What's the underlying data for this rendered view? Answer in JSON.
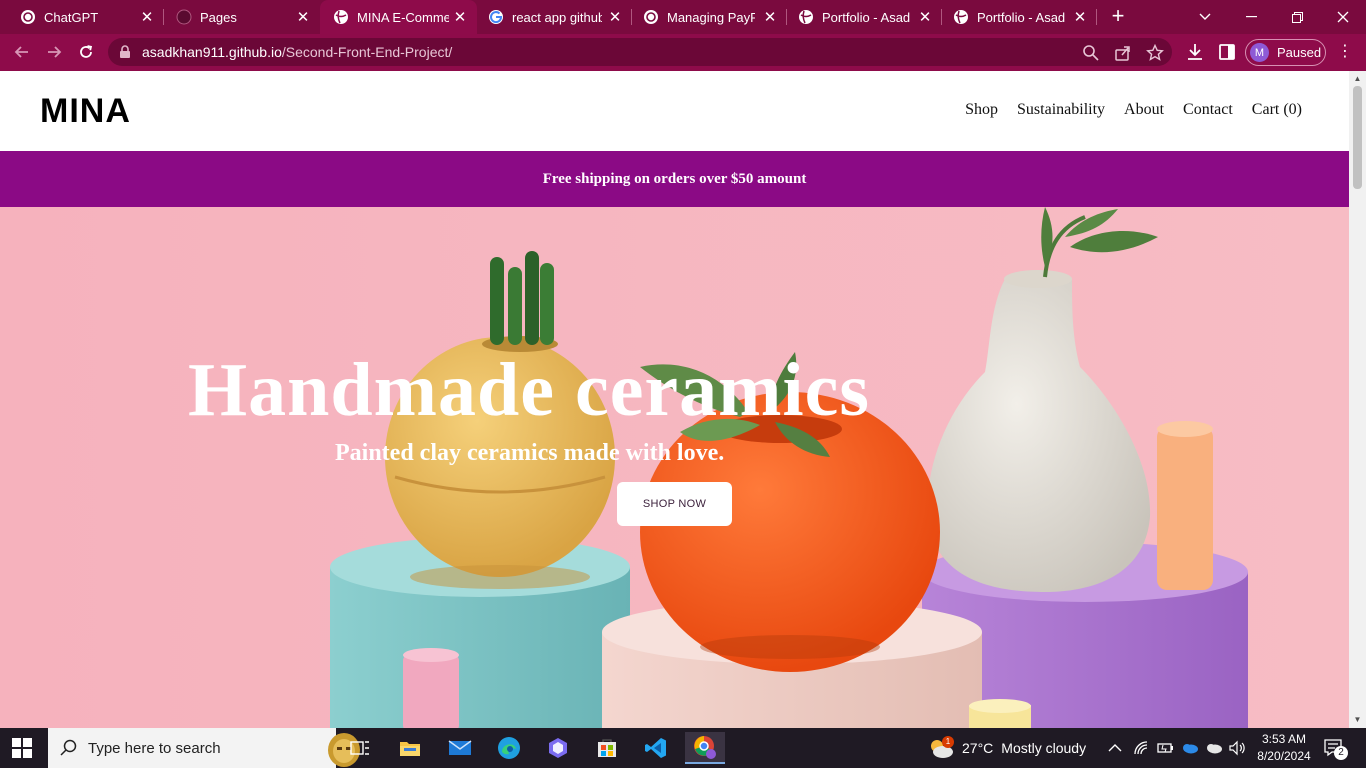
{
  "browser": {
    "tabs": [
      {
        "title": "ChatGPT",
        "icon": "openai-icon",
        "active": false
      },
      {
        "title": "Pages",
        "icon": "github-icon",
        "active": false
      },
      {
        "title": "MINA E-Commerce",
        "icon": "globe-icon",
        "active": true
      },
      {
        "title": "react app github",
        "icon": "google-icon",
        "active": false
      },
      {
        "title": "Managing PayPal",
        "icon": "openai-icon",
        "active": false
      },
      {
        "title": "Portfolio - Asad",
        "icon": "globe-icon",
        "active": false
      },
      {
        "title": "Portfolio - Asad",
        "icon": "globe-icon",
        "active": false
      }
    ],
    "url_host": "asadkhan911.github.io",
    "url_path": "/Second-Front-End-Project/",
    "profile_initial": "M",
    "profile_status": "Paused",
    "accent_color": "#8e0b4a"
  },
  "site": {
    "logo": "MINA",
    "nav": [
      "Shop",
      "Sustainability",
      "About",
      "Contact",
      "Cart (0)"
    ],
    "promo": "Free shipping on orders over $50 amount",
    "promo_color": "#8b0a85",
    "hero": {
      "title": "Handmade ceramics",
      "subtitle": "Painted clay ceramics made with love.",
      "cta": "SHOP NOW",
      "background_color": "#f4b3be"
    }
  },
  "taskbar": {
    "search_placeholder": "Type here to search",
    "weather_temp": "27°C",
    "weather_text": "Mostly cloudy",
    "weather_badge": "1",
    "time": "3:53 AM",
    "date": "8/20/2024",
    "notification_count": "2"
  }
}
